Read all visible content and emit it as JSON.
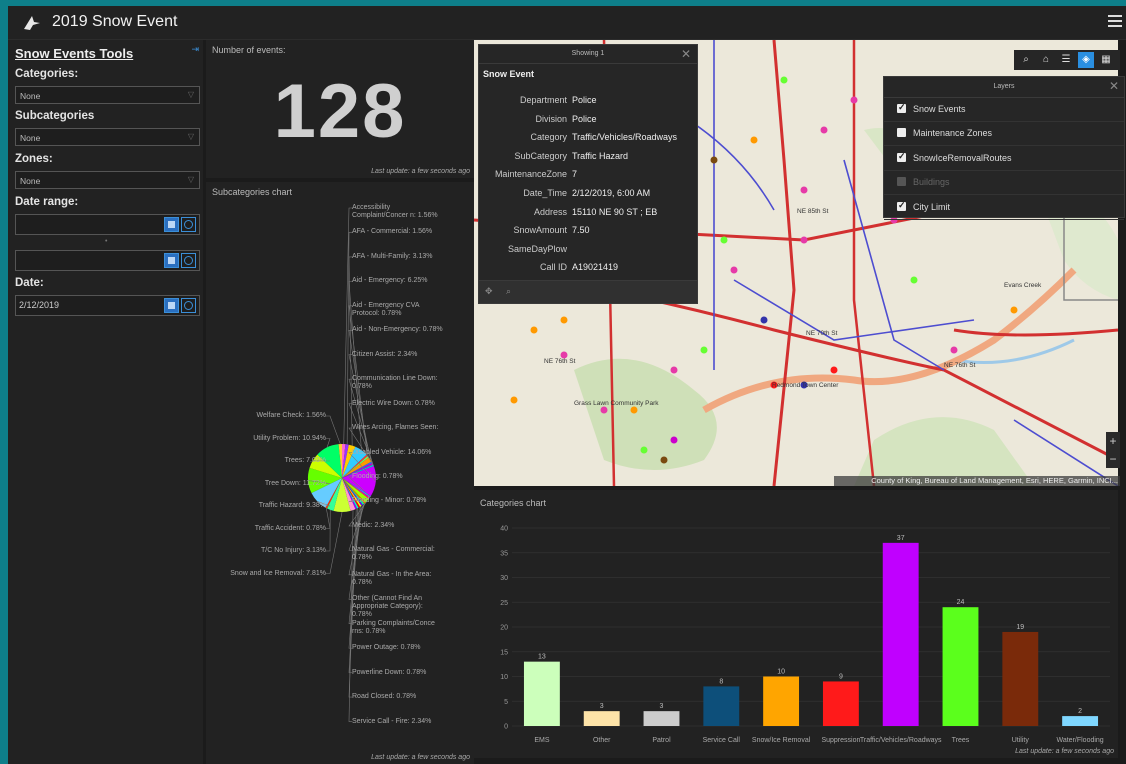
{
  "app": {
    "title": "2019 Snow Event",
    "logo_icon": "plane-logo-icon",
    "menu_icon": "hamburger-menu-icon"
  },
  "sidebar": {
    "title": "Snow Events Tools",
    "categories_label": "Categories:",
    "categories_value": "None",
    "subcategories_label": "Subcategories",
    "subcategories_value": "None",
    "zones_label": "Zones:",
    "zones_value": "None",
    "date_range_label": "Date range:",
    "date_range_start": "",
    "date_range_end": "",
    "date_label": "Date:",
    "date_value": "2/12/2019"
  },
  "number_panel": {
    "title": "Number of events:",
    "value": "128",
    "updated": "Last update: a few seconds ago"
  },
  "subcat_panel": {
    "title": "Subcategories chart",
    "updated": "Last update: a few seconds ago"
  },
  "popup": {
    "header": "Showing 1",
    "title": "Snow Event",
    "rows": [
      {
        "k": "Department",
        "v": "Police"
      },
      {
        "k": "Division",
        "v": "Police"
      },
      {
        "k": "Category",
        "v": "Traffic/Vehicles/Roadways"
      },
      {
        "k": "SubCategory",
        "v": "Traffic Hazard"
      },
      {
        "k": "MaintenanceZone",
        "v": "7"
      },
      {
        "k": "Date_Time",
        "v": "2/12/2019, 6:00 AM"
      },
      {
        "k": "Address",
        "v": "15110 NE 90 ST ; EB"
      },
      {
        "k": "SnowAmount",
        "v": "7.50"
      },
      {
        "k": "SameDayPlow",
        "v": ""
      },
      {
        "k": "Call ID",
        "v": "A19021419"
      }
    ]
  },
  "layers": {
    "title": "Layers",
    "items": [
      {
        "label": "Snow Events",
        "checked": true
      },
      {
        "label": "Maintenance Zones",
        "checked": false
      },
      {
        "label": "SnowIceRemovalRoutes",
        "checked": true
      },
      {
        "label": "Buildings",
        "checked": false,
        "disabled": true
      },
      {
        "label": "City Limit",
        "checked": true
      }
    ]
  },
  "map": {
    "attribution": "County of King, Bureau of Land Management, Esri, HERE, Garmin, INCI...",
    "labels": [
      "NE 85th St",
      "NE 76th St",
      "Redmond Town Center",
      "NE 76th St",
      "Evans Creek",
      "Grass Lawn Community Park",
      "NE 70th St"
    ],
    "zoom_in": "+",
    "zoom_out": "−"
  },
  "categories_panel": {
    "title": "Categories chart",
    "updated": "Last update: a few seconds ago"
  },
  "chart_data": [
    {
      "type": "bar",
      "title": "Categories chart",
      "categories": [
        "EMS",
        "Other",
        "Patrol",
        "Service Call",
        "Snow/Ice Removal",
        "Suppression",
        "Traffic/Vehicles/Roadways",
        "Trees",
        "Utility",
        "Water/Flooding"
      ],
      "values": [
        13,
        3,
        3,
        8,
        10,
        9,
        37,
        24,
        19,
        2
      ],
      "colors": [
        "#ccffbb",
        "#fde3a8",
        "#cccccc",
        "#0d4f7a",
        "#ffa500",
        "#ff1a1a",
        "#c000ff",
        "#5bff1c",
        "#7a2a0a",
        "#7fd7ff"
      ],
      "ylim": [
        0,
        40
      ],
      "yticks": [
        0,
        5,
        10,
        15,
        20,
        25,
        30,
        35,
        40
      ],
      "grid": true
    },
    {
      "type": "pie",
      "title": "Subcategories chart",
      "labels": [
        "Accessibility Complaint/Concern",
        "AFA - Commercial",
        "AFA - Multi-Family",
        "Aid - Emergency",
        "Aid - Emergency CVA Protocol",
        "Aid - Non-Emergency",
        "Citizen Assist",
        "Communication Line Down",
        "Electric Wire Down",
        "Wires Arcing",
        "Disabled Vehicle",
        "Flooding",
        "Flooding - Minor",
        "Medic",
        "Natural Gas - Commercial",
        "Natural Gas - In the Area",
        "Other (Cannot Find An Appropriate Category)",
        "Parking Complaints/Concerns",
        "Power Outage",
        "Powerline Down",
        "Road Closed",
        "Service Call - Fire",
        "Snow and Ice Removal",
        "T/C No Injury",
        "Traffic Accident",
        "Traffic Hazard",
        "Tree Down",
        "Trees",
        "Utility Problem",
        "Welfare Check"
      ],
      "values": [
        1.56,
        1.56,
        3.13,
        6.25,
        0.78,
        0.78,
        2.34,
        0.78,
        0.78,
        0.78,
        14.06,
        0.78,
        0.78,
        2.34,
        0.78,
        0.78,
        0.78,
        0.78,
        0.78,
        0.78,
        0.78,
        2.34,
        7.81,
        3.13,
        0.78,
        9.38,
        11.72,
        7.03,
        10.94,
        1.56
      ],
      "colors": [
        "#ff66cc",
        "#9933ff",
        "#ffcc00",
        "#33ccff",
        "#ff3333",
        "#66ff66",
        "#ff9900",
        "#3366ff",
        "#cc00cc",
        "#00cccc",
        "#cc00ff",
        "#3399ff",
        "#ff0099",
        "#99ff00",
        "#ff6600",
        "#00ff99",
        "#6600ff",
        "#ffff00",
        "#ff0000",
        "#00ffcc",
        "#9900ff",
        "#ff99cc",
        "#ccff33",
        "#33ff99",
        "#ff3300",
        "#66ccff",
        "#66ff00",
        "#ccff00",
        "#00ff66",
        "#ffcc33"
      ],
      "label_texts": [
        "Accessibility Complaint/Concer n: 1.56%",
        "AFA - Commercial: 1.56%",
        "AFA - Multi-Family: 3.13%",
        "Aid - Emergency: 6.25%",
        "Aid - Emergency CVA Protocol: 0.78%",
        "Aid - Non-Emergency: 0.78%",
        "Citizen Assist: 2.34%",
        "Communication Line Down: 0.78%",
        "Electric Wire Down: 0.78%",
        "Wires Arcing, Flames Seen:",
        "Disabled Vehicle: 14.06%",
        "Flooding: 0.78%",
        "Flooding - Minor: 0.78%",
        "Medic: 2.34%",
        "Natural Gas - Commercial: 0.78%",
        "Natural Gas - In the Area: 0.78%",
        "Other (Cannot Find An Appropriate Category): 0.78%",
        "Parking Complaints/Conce rns: 0.78%",
        "Power Outage: 0.78%",
        "Powerline Down: 0.78%",
        "Road Closed: 0.78%",
        "Service Call - Fire: 2.34%",
        "Snow and Ice Removal: 7.81%",
        "T/C No Injury: 3.13%",
        "Traffic Accident: 0.78%",
        "Traffic Hazard: 9.38%",
        "Tree Down: 11.72%",
        "Trees: 7.03%",
        "Utility Problem: 10.94%",
        "Welfare Check: 1.56%"
      ]
    }
  ]
}
